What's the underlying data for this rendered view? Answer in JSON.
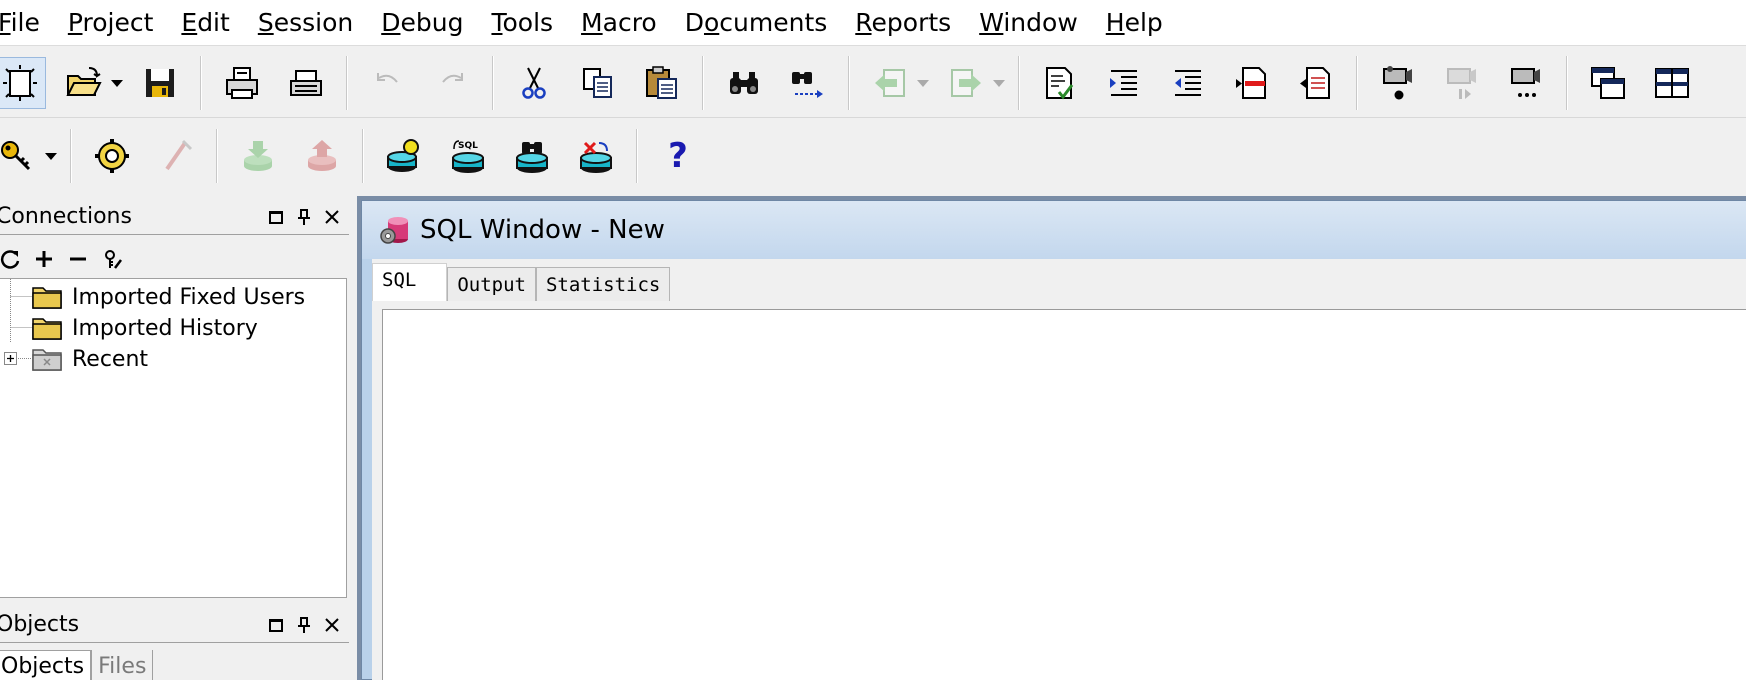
{
  "menu": {
    "items": [
      {
        "pre": "",
        "key": "F",
        "post": "ile"
      },
      {
        "pre": "",
        "key": "P",
        "post": "roject"
      },
      {
        "pre": "",
        "key": "E",
        "post": "dit"
      },
      {
        "pre": "",
        "key": "S",
        "post": "ession"
      },
      {
        "pre": "",
        "key": "D",
        "post": "ebug"
      },
      {
        "pre": "",
        "key": "T",
        "post": "ools"
      },
      {
        "pre": "",
        "key": "M",
        "post": "acro"
      },
      {
        "pre": "D",
        "key": "o",
        "post": "cuments"
      },
      {
        "pre": "",
        "key": "R",
        "post": "eports"
      },
      {
        "pre": "",
        "key": "W",
        "post": "indow"
      },
      {
        "pre": "",
        "key": "H",
        "post": "elp"
      }
    ]
  },
  "toolbar1": {
    "icons": [
      "new-icon",
      "open-icon",
      "save-icon",
      "print-icon",
      "print-setup-icon",
      "undo-icon",
      "redo-icon",
      "cut-icon",
      "copy-icon",
      "paste-icon",
      "find-icon",
      "find-next-icon",
      "back-icon",
      "forward-icon",
      "check-doc-icon",
      "indent-icon",
      "unindent-icon",
      "comment-icon",
      "uncomment-icon",
      "record-icon",
      "play-icon",
      "macro-icon",
      "cascade-icon",
      "tile-icon"
    ]
  },
  "toolbar2": {
    "icons": [
      "key-icon",
      "compile-icon",
      "plug-icon",
      "import-icon",
      "export-icon",
      "db-bulb-icon",
      "db-sql-icon",
      "db-binocular-icon",
      "db-delete-icon",
      "help-icon"
    ],
    "help_glyph": "?"
  },
  "connections_panel": {
    "title": "Connections",
    "tree": [
      {
        "label": "Imported Fixed Users",
        "expandable": false
      },
      {
        "label": "Imported History",
        "expandable": false
      },
      {
        "label": "Recent",
        "expandable": true
      }
    ]
  },
  "objects_panel": {
    "title": "Objects",
    "tabs": [
      "Objects",
      "Files"
    ]
  },
  "sql_window": {
    "title": "SQL Window - New",
    "tabs": [
      "SQL",
      "Output",
      "Statistics"
    ],
    "active_tab": "SQL",
    "editor_text": ""
  },
  "colors": {
    "menubar_bg": "#ffffff",
    "toolbar_bg": "#f0f0f0",
    "mdi_title_gradient_top": "#dbe7f4",
    "mdi_title_gradient_bottom": "#c3d7ed",
    "help_blue": "#1a1ab0"
  }
}
